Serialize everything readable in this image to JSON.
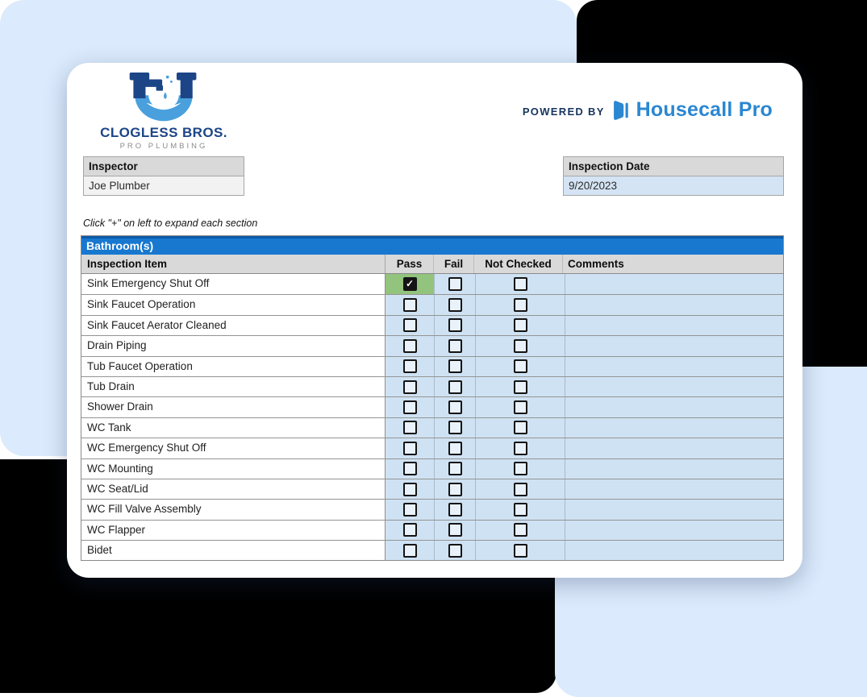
{
  "brand": {
    "company_name": "CLOGLESS BROS.",
    "company_tagline": "PRO PLUMBING",
    "logo_icon": "u-pipe-faucet-icon",
    "powered_by_label": "POWERED BY",
    "powered_by_brand": "Housecall Pro",
    "powered_by_icon": "housecall-pro-door-icon"
  },
  "fields": {
    "inspector_label": "Inspector",
    "inspector_value": "Joe Plumber",
    "inspection_date_label": "Inspection Date",
    "inspection_date_value": "9/20/2023"
  },
  "note": "Click \"+\" on left to expand each section",
  "section": {
    "title": "Bathroom(s)",
    "columns": [
      "Inspection Item",
      "Pass",
      "Fail",
      "Not Checked",
      "Comments"
    ],
    "rows": [
      {
        "item": "Sink Emergency Shut Off",
        "pass": true,
        "fail": false,
        "not_checked": false,
        "comment": ""
      },
      {
        "item": "Sink Faucet Operation",
        "pass": false,
        "fail": false,
        "not_checked": false,
        "comment": ""
      },
      {
        "item": "Sink Faucet Aerator Cleaned",
        "pass": false,
        "fail": false,
        "not_checked": false,
        "comment": ""
      },
      {
        "item": "Drain Piping",
        "pass": false,
        "fail": false,
        "not_checked": false,
        "comment": ""
      },
      {
        "item": "Tub Faucet Operation",
        "pass": false,
        "fail": false,
        "not_checked": false,
        "comment": ""
      },
      {
        "item": "Tub Drain",
        "pass": false,
        "fail": false,
        "not_checked": false,
        "comment": ""
      },
      {
        "item": "Shower Drain",
        "pass": false,
        "fail": false,
        "not_checked": false,
        "comment": ""
      },
      {
        "item": "WC Tank",
        "pass": false,
        "fail": false,
        "not_checked": false,
        "comment": ""
      },
      {
        "item": "WC Emergency Shut Off",
        "pass": false,
        "fail": false,
        "not_checked": false,
        "comment": ""
      },
      {
        "item": "WC Mounting",
        "pass": false,
        "fail": false,
        "not_checked": false,
        "comment": ""
      },
      {
        "item": "WC Seat/Lid",
        "pass": false,
        "fail": false,
        "not_checked": false,
        "comment": ""
      },
      {
        "item": "WC Fill Valve Assembly",
        "pass": false,
        "fail": false,
        "not_checked": false,
        "comment": ""
      },
      {
        "item": "WC Flapper",
        "pass": false,
        "fail": false,
        "not_checked": false,
        "comment": ""
      },
      {
        "item": "Bidet",
        "pass": false,
        "fail": false,
        "not_checked": false,
        "comment": ""
      }
    ]
  },
  "colors": {
    "section_bar_blue": "#1878d0",
    "section_bar_top_border": "#0d5ba8",
    "table_cell_blue": "#cfe2f3",
    "date_cell_blue": "#d4e4f4",
    "pass_green": "#93c47d",
    "header_gray": "#d9d9d9",
    "background_light_blue": "#dbeafc",
    "background_black": "#000000",
    "brand_navy": "#1c4587",
    "brand_sky_blue": "#4aa0dd",
    "housecall_blue": "#2b87d2",
    "powered_navy": "#17355e"
  }
}
